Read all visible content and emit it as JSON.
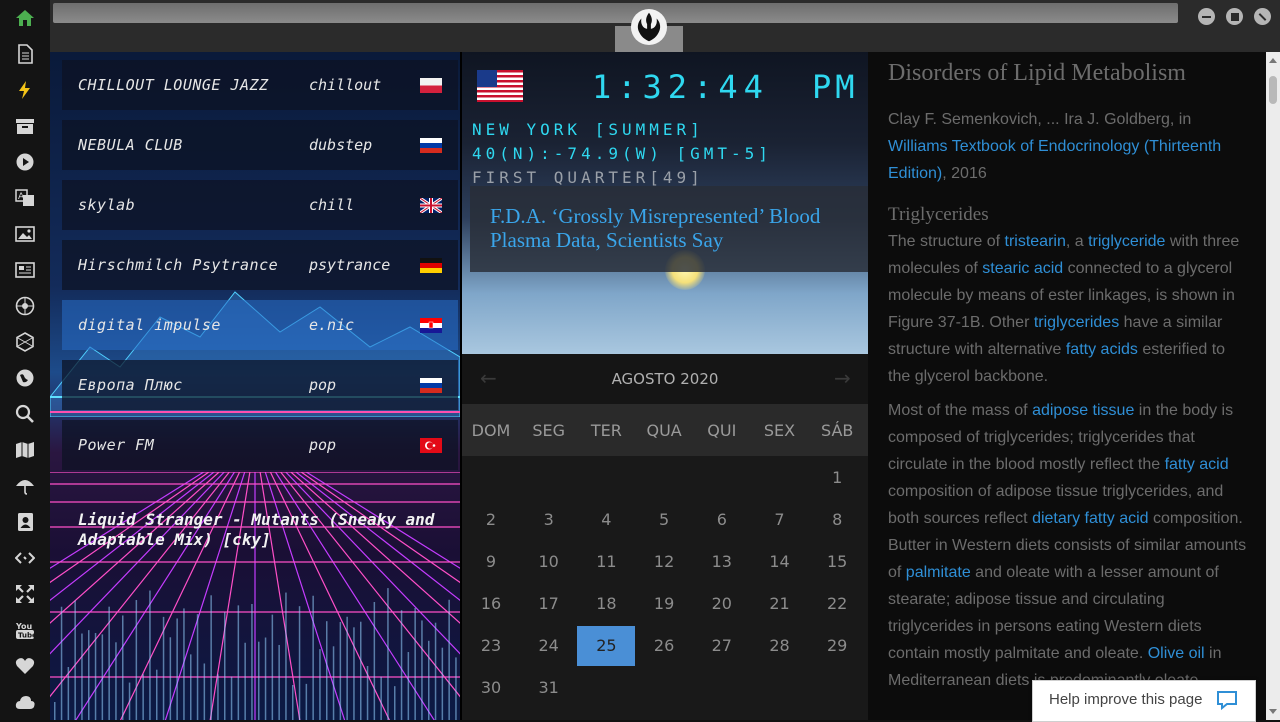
{
  "sidebar": {
    "icons": [
      "home-icon",
      "document-icon",
      "bolt-icon",
      "archive-icon",
      "play-icon",
      "translate-icon",
      "image-icon",
      "newspaper-icon",
      "rebel-icon",
      "hexagon-icon",
      "globe-icon",
      "search-icon",
      "map-icon",
      "umbrella-icon",
      "contact-icon",
      "code-icon",
      "expand-icon",
      "youtube-icon",
      "heart-icon",
      "cloud-icon"
    ],
    "active_color": "#4caf50"
  },
  "radio": {
    "stations": [
      {
        "name": "CHILLOUT LOUNGE JAZZ",
        "genre": "chillout",
        "flag": "pl"
      },
      {
        "name": "NEBULA CLUB",
        "genre": "dubstep",
        "flag": "ru"
      },
      {
        "name": "skylab",
        "genre": "chill",
        "flag": "gb"
      },
      {
        "name": "Hirschmilch Psytrance",
        "genre": "psytrance",
        "flag": "de"
      },
      {
        "name": "digital impulse",
        "genre": "e.nic",
        "flag": "hr"
      },
      {
        "name": "Европа Плюс",
        "genre": "pop",
        "flag": "ru"
      },
      {
        "name": "Power FM",
        "genre": "pop",
        "flag": "tr"
      }
    ],
    "now_playing": "Liquid Stranger - Mutants (Sneaky and Adaptable Mix) [cky]"
  },
  "clock": {
    "time": "1:32:44",
    "ampm": "PM",
    "city": "NEW YORK [SUMMER]",
    "coords": "40(N):-74.9(W) [GMT-5]",
    "moon": "FIRST QUARTER[49]",
    "accent": "#2fd8f0"
  },
  "news": {
    "headline": "F.D.A. ‘Grossly Misrepresented’ Blood Plasma Data, Scientists Say"
  },
  "calendar": {
    "month": "AGOSTO 2020",
    "weekdays": [
      "DOM",
      "SEG",
      "TER",
      "QUA",
      "QUI",
      "SEX",
      "SÁB"
    ],
    "first_weekday_index": 6,
    "days_in_month": 31,
    "selected": 25,
    "selected_color": "#4a8fd6"
  },
  "article": {
    "title": "Disorders of Lipid Metabolism",
    "authors": "Clay F. Semenkovich, ... Ira J. Goldberg, in",
    "book": "Williams Textbook of Endocrinology (Thirteenth Edition)",
    "year": ", 2016",
    "section": "Triglycerides",
    "p1": [
      {
        "t": "The structure of "
      },
      {
        "t": "tristearin",
        "link": true
      },
      {
        "t": ", a "
      },
      {
        "t": "triglyceride",
        "link": true
      },
      {
        "t": " with three molecules of "
      },
      {
        "t": "stearic acid",
        "link": true
      },
      {
        "t": " connected to a glycerol molecule by means of ester linkages, is shown in Figure 37-1B. Other "
      },
      {
        "t": "triglycerides",
        "link": true
      },
      {
        "t": " have a similar structure with alternative "
      },
      {
        "t": "fatty acids",
        "link": true
      },
      {
        "t": " esterified to the glycerol backbone."
      }
    ],
    "p2": [
      {
        "t": "Most of the mass of "
      },
      {
        "t": "adipose tissue",
        "link": true
      },
      {
        "t": " in the body is composed of triglycerides; triglycerides that circulate in the blood mostly reflect the "
      },
      {
        "t": "fatty acid",
        "link": true
      },
      {
        "t": " composition of adipose tissue triglycerides, and both sources reflect "
      },
      {
        "t": "dietary fatty acid",
        "link": true
      },
      {
        "t": " composition. Butter in Western diets consists of similar amounts of "
      },
      {
        "t": "palmitate",
        "link": true
      },
      {
        "t": " and oleate with a lesser amount of stearate; adipose tissue and circulating triglycerides in persons eating Western diets contain mostly palmitate and oleate. "
      },
      {
        "t": "Olive oil",
        "link": true
      },
      {
        "t": " in Mediterranean diets is predominantly oleate"
      }
    ],
    "help_label": "Help improve this page"
  }
}
